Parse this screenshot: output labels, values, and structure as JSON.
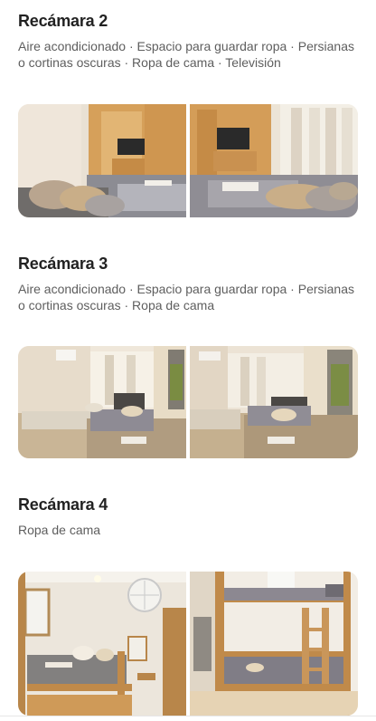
{
  "rooms": [
    {
      "title": "Recámara 2",
      "amenities": "Aire acondicionado · Espacio para guardar ropa · Persianas o cortinas oscuras · Ropa de cama · Televisión"
    },
    {
      "title": "Recámara 3",
      "amenities": "Aire acondicionado · Espacio para guardar ropa · Persianas o cortinas oscuras · Ropa de cama"
    },
    {
      "title": "Recámara 4",
      "amenities": "Ropa de cama"
    }
  ]
}
